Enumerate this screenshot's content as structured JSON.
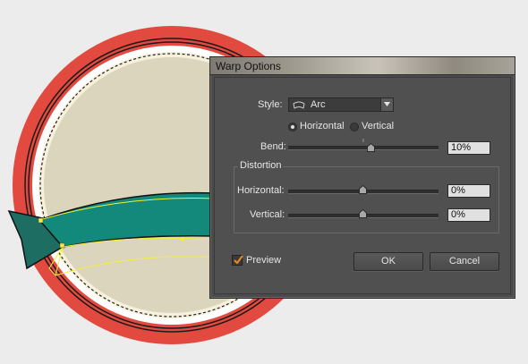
{
  "dialog": {
    "title": "Warp Options",
    "style_label": "Style:",
    "style_value": "Arc",
    "style_icon": "arc-warp-icon",
    "orientation": {
      "horizontal_label": "Horizontal",
      "vertical_label": "Vertical",
      "selected": "Horizontal"
    },
    "bend": {
      "label": "Bend:",
      "value": "10%",
      "slider_fraction": 0.55
    },
    "distortion": {
      "title": "Distortion",
      "horizontal": {
        "label": "Horizontal:",
        "value": "0%",
        "slider_fraction": 0.5
      },
      "vertical": {
        "label": "Vertical:",
        "value": "0%",
        "slider_fraction": 0.5
      }
    },
    "preview": {
      "label": "Preview",
      "checked": true
    },
    "ok_label": "OK",
    "cancel_label": "Cancel"
  },
  "colors": {
    "outer_ring": "#e24a3f",
    "badge_face": "#dcd5bd",
    "ribbon": "#12897a",
    "selection": "#f5ef3a",
    "dialog_bg": "#505050"
  }
}
